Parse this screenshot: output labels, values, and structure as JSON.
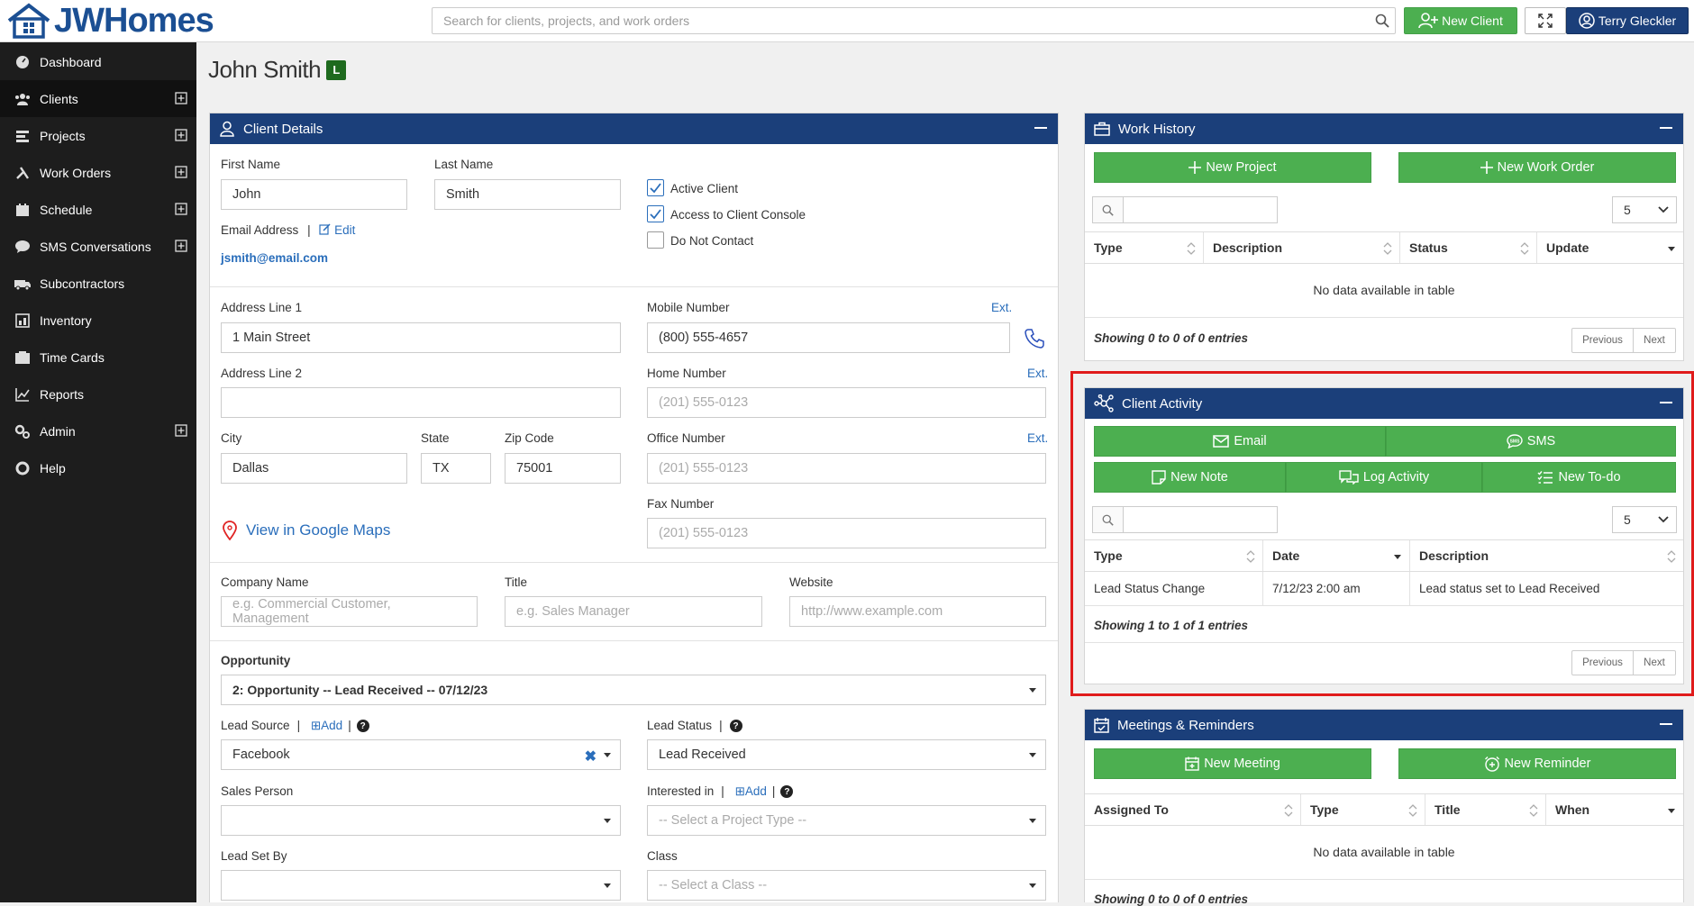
{
  "app": {
    "logo_text": "JWHomes"
  },
  "topbar": {
    "search_placeholder": "Search for clients, projects, and work orders",
    "new_client_label": "New Client",
    "user_label": "Terry Gleckler"
  },
  "sidebar": {
    "items": [
      {
        "label": "Dashboard",
        "icon": "dashboard-icon",
        "expandable": false
      },
      {
        "label": "Clients",
        "icon": "clients-icon",
        "expandable": true
      },
      {
        "label": "Projects",
        "icon": "projects-icon",
        "expandable": true
      },
      {
        "label": "Work Orders",
        "icon": "tools-icon",
        "expandable": true
      },
      {
        "label": "Schedule",
        "icon": "calendar-icon",
        "expandable": true
      },
      {
        "label": "SMS Conversations",
        "icon": "sms-icon",
        "expandable": true
      },
      {
        "label": "Subcontractors",
        "icon": "truck-icon",
        "expandable": false
      },
      {
        "label": "Inventory",
        "icon": "inventory-icon",
        "expandable": false
      },
      {
        "label": "Time Cards",
        "icon": "timecard-icon",
        "expandable": false
      },
      {
        "label": "Reports",
        "icon": "reports-icon",
        "expandable": false
      },
      {
        "label": "Admin",
        "icon": "gears-icon",
        "expandable": true
      },
      {
        "label": "Help",
        "icon": "help-icon",
        "expandable": false
      }
    ]
  },
  "page": {
    "title": "John Smith",
    "badge": "L"
  },
  "client_details": {
    "header": "Client Details",
    "first_name_label": "First Name",
    "first_name": "John",
    "last_name_label": "Last Name",
    "last_name": "Smith",
    "email_label": "Email Address",
    "edit_label": "Edit",
    "email": "jsmith@email.com",
    "active_client": "Active Client",
    "client_console": "Access to Client Console",
    "do_not_contact": "Do Not Contact",
    "address1_label": "Address Line 1",
    "address1": "1 Main Street",
    "address2_label": "Address Line 2",
    "address2": "",
    "city_label": "City",
    "city": "Dallas",
    "state_label": "State",
    "state": "TX",
    "zip_label": "Zip Code",
    "zip": "75001",
    "maps_link": "View in Google Maps",
    "mobile_label": "Mobile Number",
    "mobile": "(800) 555-4657",
    "home_label": "Home Number",
    "home_placeholder": "(201) 555-0123",
    "office_label": "Office Number",
    "office_placeholder": "(201) 555-0123",
    "fax_label": "Fax Number",
    "fax_placeholder": "(201) 555-0123",
    "ext_label": "Ext.",
    "company_label": "Company Name",
    "company_placeholder": "e.g. Commercial Customer, Management",
    "title_label": "Title",
    "title_placeholder": "e.g. Sales Manager",
    "website_label": "Website",
    "website_placeholder": "http://www.example.com",
    "opportunity_label": "Opportunity",
    "opportunity": "2: Opportunity -- Lead Received -- 07/12/23",
    "lead_source_label": "Lead Source",
    "add_label": "Add",
    "lead_source": "Facebook",
    "lead_status_label": "Lead Status",
    "lead_status": "Lead Received",
    "sales_person_label": "Sales Person",
    "sales_person": "",
    "interested_label": "Interested in",
    "interested_placeholder": "-- Select a Project Type --",
    "lead_set_by_label": "Lead Set By",
    "lead_set_by": "",
    "class_label": "Class",
    "class_placeholder": "-- Select a Class --"
  },
  "work_history": {
    "header": "Work History",
    "new_project": "New Project",
    "new_work_order": "New Work Order",
    "page_size": "5",
    "columns": [
      "Type",
      "Description",
      "Status",
      "Update"
    ],
    "empty": "No data available in table",
    "showing": "Showing 0 to 0 of 0 entries",
    "prev": "Previous",
    "next": "Next"
  },
  "client_activity": {
    "header": "Client Activity",
    "email": "Email",
    "sms": "SMS",
    "new_note": "New Note",
    "log_activity": "Log Activity",
    "new_todo": "New To-do",
    "page_size": "5",
    "columns": [
      "Type",
      "Date",
      "Description"
    ],
    "rows": [
      [
        "Lead Status Change",
        "7/12/23 2:00 am",
        "Lead status set to Lead Received"
      ]
    ],
    "showing": "Showing 1 to 1 of 1 entries",
    "prev": "Previous",
    "next": "Next"
  },
  "meetings": {
    "header": "Meetings & Reminders",
    "new_meeting": "New Meeting",
    "new_reminder": "New Reminder",
    "columns": [
      "Assigned To",
      "Type",
      "Title",
      "When"
    ],
    "empty": "No data available in table",
    "showing": "Showing 0 to 0 of 0 entries"
  },
  "colors": {
    "primary": "#1b3f7a",
    "success": "#4caf50",
    "sidebar": "#1d1d1d",
    "highlight": "#e01b1b",
    "link": "#2a6ebb"
  }
}
